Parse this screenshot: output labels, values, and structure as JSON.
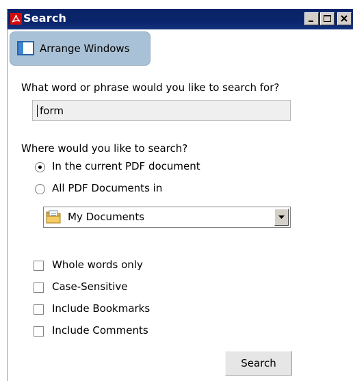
{
  "window": {
    "title": "Search",
    "buttons": {
      "minimize_icon": "minimize-icon",
      "maximize_icon": "maximize-icon",
      "close_icon": "close-icon"
    }
  },
  "toolbar": {
    "arrange_label": "Arrange Windows",
    "arrange_icon": "arrange-windows-icon"
  },
  "search": {
    "question": "What word or phrase would you like to search for?",
    "value": "form"
  },
  "scope": {
    "question": "Where would you like to search?",
    "options": [
      {
        "label": "In the current PDF document",
        "selected": true
      },
      {
        "label": "All PDF Documents in",
        "selected": false
      }
    ],
    "location": {
      "value": "My Documents",
      "icon": "folder-icon"
    }
  },
  "options": [
    {
      "label": "Whole words only",
      "checked": false
    },
    {
      "label": "Case-Sensitive",
      "checked": false
    },
    {
      "label": "Include Bookmarks",
      "checked": false
    },
    {
      "label": "Include Comments",
      "checked": false
    }
  ],
  "actions": {
    "search_label": "Search"
  },
  "colors": {
    "titlebar": "#0a246a",
    "arrange_button": "#a9c1d6",
    "field_background": "#efefef"
  }
}
